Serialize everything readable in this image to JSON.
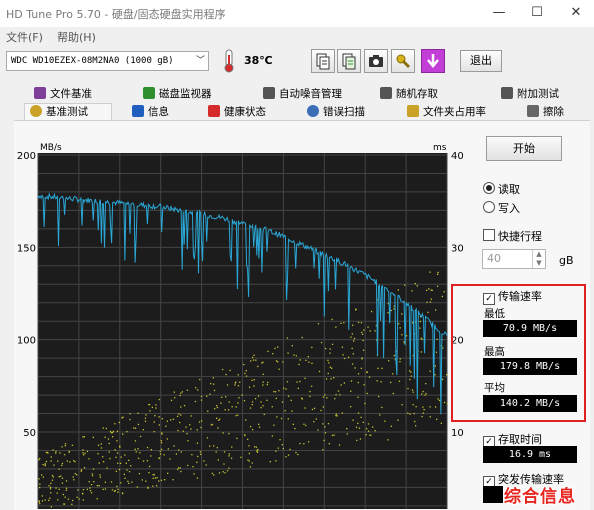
{
  "window": {
    "title": "HD Tune Pro 5.70 - 硬盘/固态硬盘实用程序",
    "controls": [
      "—",
      "☐",
      "✕"
    ]
  },
  "menu": [
    "文件(F)",
    "帮助(H)"
  ],
  "toolbar": {
    "drive": "WDC WD10EZEX-08M2NA0 (1000 gB)",
    "temperature": "38℃",
    "exit_label": "退出"
  },
  "tabs_row1": [
    {
      "label": "文件基准",
      "icon_color": "#7d3f98"
    },
    {
      "label": "磁盘监视器",
      "icon_color": "#2f8f2f"
    },
    {
      "label": "自动噪音管理",
      "icon_color": "#555555"
    },
    {
      "label": "随机存取",
      "icon_color": "#555555"
    },
    {
      "label": "附加测试",
      "icon_color": "#555555"
    }
  ],
  "tabs_row2": [
    {
      "label": "基准测试",
      "icon_color": "#c9a227"
    },
    {
      "label": "信息",
      "icon_color": "#1f5fbf"
    },
    {
      "label": "健康状态",
      "icon_color": "#d52b2b"
    },
    {
      "label": "错误扫描",
      "icon_color": "#3a6fb5"
    },
    {
      "label": "文件夹占用率",
      "icon_color": "#c9a227"
    },
    {
      "label": "擦除",
      "icon_color": "#666666"
    }
  ],
  "benchmark": {
    "start_label": "开始",
    "read_label": "读取",
    "write_label": "写入",
    "mode": "read",
    "short_stroke_label": "快捷行程",
    "short_stroke_value": "40",
    "short_stroke_unit": "gB",
    "transfer_rate_label": "传输速率",
    "min_label": "最低",
    "min_value": "70.9 MB/s",
    "max_label": "最高",
    "max_value": "179.8 MB/s",
    "avg_label": "平均",
    "avg_value": "140.2 MB/s",
    "access_time_label": "存取时间",
    "access_time_value": "16.9 ms",
    "burst_rate_label": "突发传输速率"
  },
  "watermark": "综合信息",
  "chart_data": {
    "type": "line",
    "left_axis_unit": "MB/s",
    "right_axis_unit": "ms",
    "left_ticks": [
      "200",
      "150",
      "100",
      "50"
    ],
    "right_ticks": [
      "40",
      "30",
      "20",
      "10"
    ],
    "ylim_left": [
      0,
      200
    ],
    "ylim_right": [
      0,
      40
    ],
    "grid": true,
    "background": "#1c1c1c",
    "series": [
      {
        "color": "#2aa7d6",
        "x": [
          0,
          5,
          10,
          15,
          20,
          25,
          30,
          35,
          40,
          45,
          50,
          55,
          60,
          65,
          70,
          75,
          80,
          85,
          90,
          95,
          100
        ],
        "values": [
          178,
          177,
          176,
          175,
          174,
          173,
          172,
          170,
          168,
          166,
          163,
          160,
          156,
          151,
          146,
          141,
          135,
          128,
          120,
          111,
          102
        ]
      },
      {
        "color": "#c8c232",
        "style": "scatter",
        "x": [
          0,
          10,
          20,
          30,
          40,
          50,
          60,
          70,
          80,
          90,
          100
        ],
        "values_ms": [
          4.5,
          6,
          7.5,
          9,
          10.5,
          12,
          13.5,
          15,
          16.5,
          18,
          19.5
        ]
      }
    ]
  }
}
